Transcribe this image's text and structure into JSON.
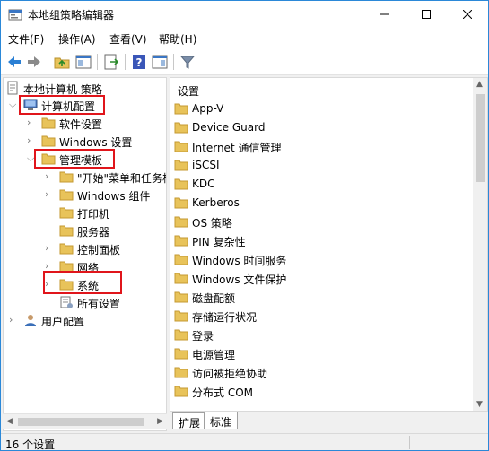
{
  "window": {
    "title": "本地组策略编辑器"
  },
  "menubar": {
    "items": [
      {
        "label": "文件(F)"
      },
      {
        "label": "操作(A)"
      },
      {
        "label": "查看(V)"
      },
      {
        "label": "帮助(H)"
      }
    ]
  },
  "toolbar": {
    "icons": [
      "back-arrow-icon",
      "forward-arrow-icon",
      "up-folder-icon",
      "show-hide-tree-icon",
      "export-list-icon",
      "help-icon",
      "show-pane-icon",
      "filter-icon"
    ]
  },
  "tree": {
    "root": "本地计算机 策略",
    "computer_config": "计算机配置",
    "software_settings": "软件设置",
    "windows_settings": "Windows 设置",
    "admin_templates": "管理模板",
    "start_menu": "\"开始\"菜单和任务栏",
    "windows_components": "Windows 组件",
    "printers": "打印机",
    "server": "服务器",
    "control_panel": "控制面板",
    "network": "网络",
    "system": "系统",
    "all_settings": "所有设置",
    "user_config": "用户配置"
  },
  "list": {
    "header": "设置",
    "items": [
      "App-V",
      "Device Guard",
      "Internet 通信管理",
      "iSCSI",
      "KDC",
      "Kerberos",
      "OS 策略",
      "PIN 复杂性",
      "Windows 时间服务",
      "Windows 文件保护",
      "磁盘配额",
      "存储运行状况",
      "登录",
      "电源管理",
      "访问被拒绝协助",
      "分布式 COM"
    ]
  },
  "tabs": {
    "extended": "扩展",
    "standard": "标准"
  },
  "status": {
    "text": "16 个设置"
  },
  "colors": {
    "highlight": "#e0151b",
    "folder": "#e8c35a",
    "accent": "#2b88d8"
  }
}
